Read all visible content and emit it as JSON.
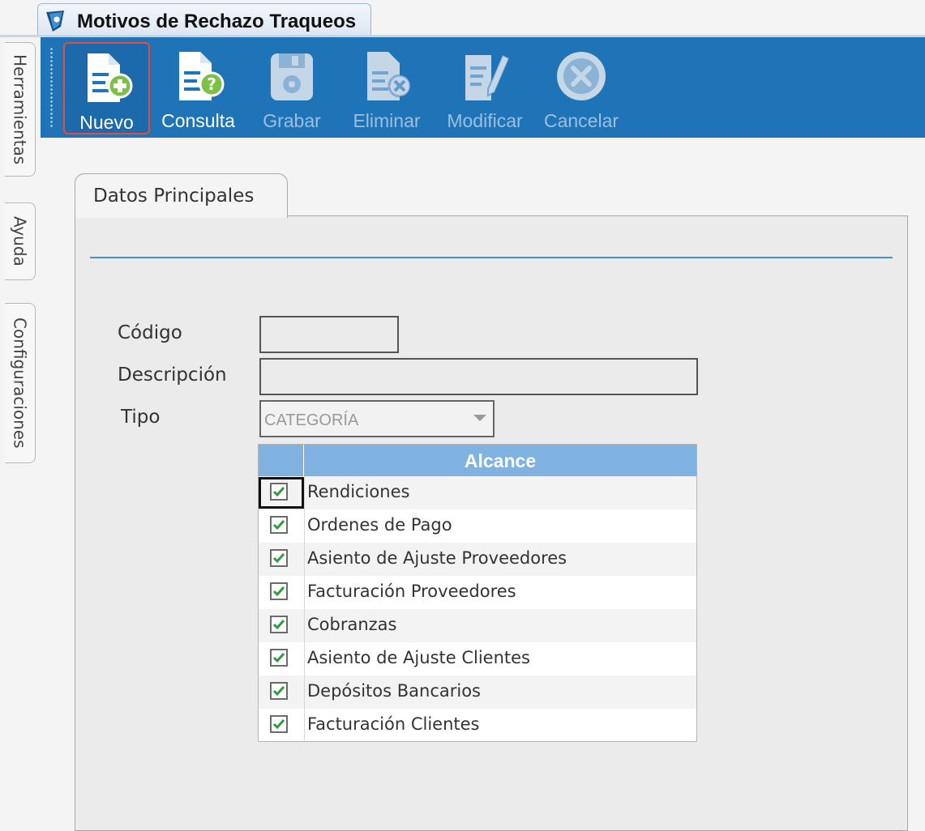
{
  "window": {
    "title": "Motivos de Rechazo Traqueos"
  },
  "side_tabs": [
    "Herramientas",
    "Ayuda",
    "Configuraciones"
  ],
  "toolbar": {
    "buttons": [
      {
        "label": "Nuevo",
        "icon": "new-document-icon",
        "enabled": true,
        "highlighted": true
      },
      {
        "label": "Consulta",
        "icon": "query-document-icon",
        "enabled": true
      },
      {
        "label": "Grabar",
        "icon": "save-icon",
        "enabled": false
      },
      {
        "label": "Eliminar",
        "icon": "delete-document-icon",
        "enabled": false
      },
      {
        "label": "Modificar",
        "icon": "edit-document-icon",
        "enabled": false
      },
      {
        "label": "Cancelar",
        "icon": "cancel-icon",
        "enabled": false
      }
    ]
  },
  "tab": {
    "label": "Datos Principales"
  },
  "form": {
    "codigo_label": "Código",
    "codigo_value": "",
    "descripcion_label": "Descripción",
    "descripcion_value": "",
    "tipo_label": "Tipo",
    "tipo_value": "CATEGORÍA"
  },
  "grid": {
    "header": "Alcance",
    "rows": [
      {
        "label": "Rendiciones",
        "checked": true
      },
      {
        "label": "Ordenes de Pago",
        "checked": true
      },
      {
        "label": "Asiento de Ajuste Proveedores",
        "checked": true
      },
      {
        "label": "Facturación Proveedores",
        "checked": true
      },
      {
        "label": "Cobranzas",
        "checked": true
      },
      {
        "label": "Asiento de Ajuste Clientes",
        "checked": true
      },
      {
        "label": "Depósitos Bancarios",
        "checked": true
      },
      {
        "label": "Facturación Clientes",
        "checked": true
      }
    ]
  },
  "colors": {
    "toolbar": "#1f73b7",
    "grid_header": "#7fb2e0",
    "check": "#2e9b3c",
    "highlight": "#e74c3c"
  }
}
